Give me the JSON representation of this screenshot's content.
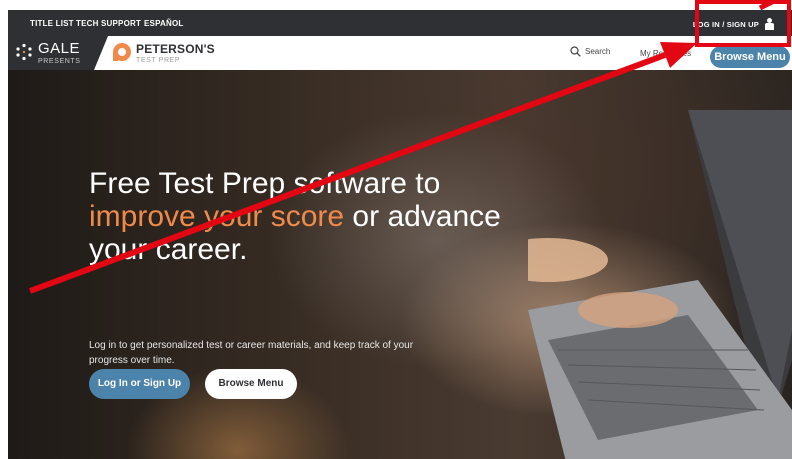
{
  "utility_nav": {
    "title_list": "TITLE LIST",
    "tech_support": "TECH SUPPORT",
    "espanol": "ESPAÑOL",
    "login": "LOG IN / SIGN UP"
  },
  "brand": {
    "gale": "GALE",
    "gale_sub": "PRESENTS",
    "peterson": "PETERSON'S",
    "peterson_sub": "TEST PREP"
  },
  "main_nav": {
    "search": "Search",
    "my_resources": "My Resources",
    "browse_menu": "Browse Menu"
  },
  "hero": {
    "headline_part1": "Free Test Prep software to ",
    "headline_accent": "improve your score",
    "headline_part2": " or advance your career.",
    "subtext": "Log in to get personalized test or career materials, and keep track of your progress over time.",
    "login_button": "Log In or Sign Up",
    "browse_button": "Browse Menu"
  },
  "colors": {
    "accent_orange": "#f08a4b",
    "button_blue": "#4b83ab",
    "utility_bar": "#2f3033",
    "annotation_red": "#e30613"
  }
}
